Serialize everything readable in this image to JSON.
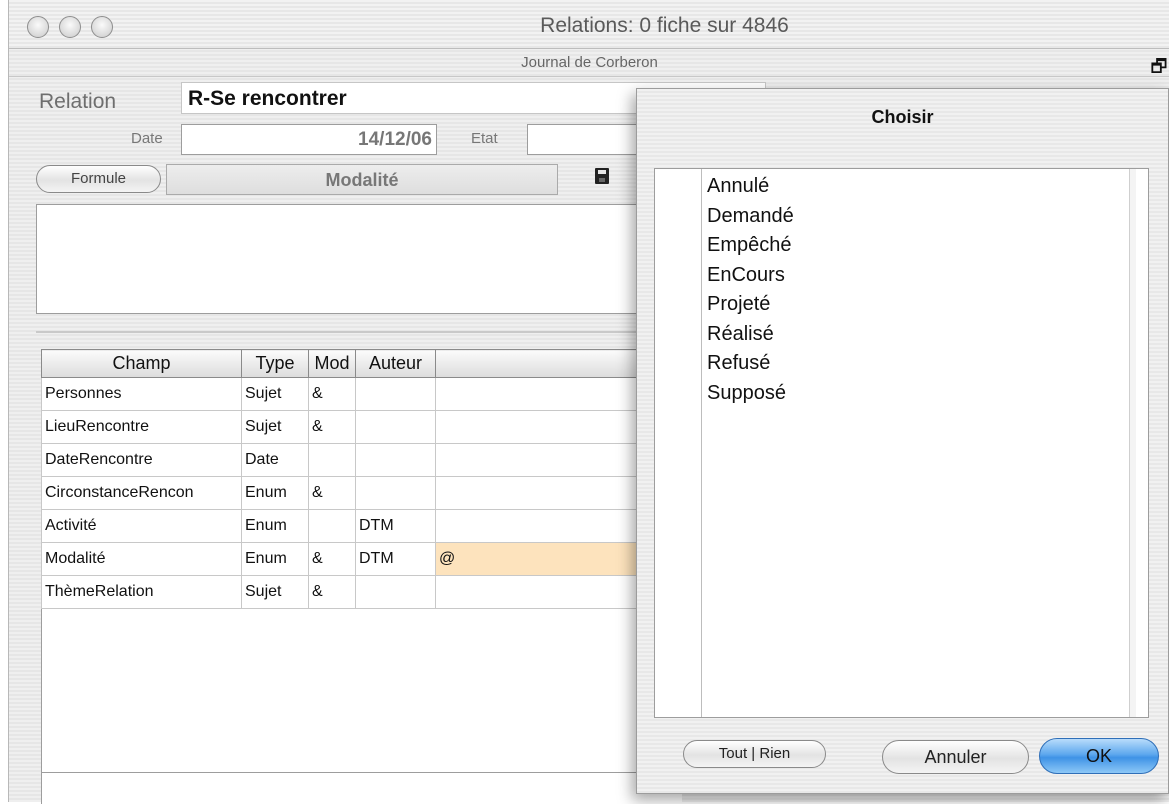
{
  "window": {
    "title": "Relations: 0 fiche sur 4846",
    "subtitle": "Journal de Corberon"
  },
  "icons": {
    "collapse": "stack-windows-icon",
    "save": "floppy-disk-icon"
  },
  "form": {
    "relation_label": "Relation",
    "relation_value": "R-Se rencontrer",
    "date_label": "Date",
    "date_value": "14/12/06",
    "etat_label": "Etat",
    "formule_button": "Formule",
    "modalite_field": "Modalité"
  },
  "table": {
    "headers": [
      "Champ",
      "Type",
      "Mod",
      "Auteur",
      ""
    ],
    "rows": [
      [
        "Personnes",
        "Sujet",
        "&",
        "",
        ""
      ],
      [
        "LieuRencontre",
        "Sujet",
        "&",
        "",
        ""
      ],
      [
        "DateRencontre",
        "Date",
        "",
        "",
        ""
      ],
      [
        "CirconstanceRencon",
        "Enum",
        "&",
        "",
        ""
      ],
      [
        "Activité",
        "Enum",
        "",
        "DTM",
        ""
      ],
      [
        "Modalité",
        "Enum",
        "&",
        "DTM",
        "@"
      ],
      [
        "ThèmeRelation",
        "Sujet",
        "&",
        "",
        ""
      ]
    ],
    "highlight_color": "#fde3bd"
  },
  "dialog": {
    "title": "Choisir",
    "items": [
      "Annulé",
      "Demandé",
      "Empêché",
      "EnCours",
      "Projeté",
      "Réalisé",
      "Refusé",
      "Supposé"
    ],
    "tout_rien": "Tout | Rien",
    "cancel": "Annuler",
    "ok": "OK"
  }
}
